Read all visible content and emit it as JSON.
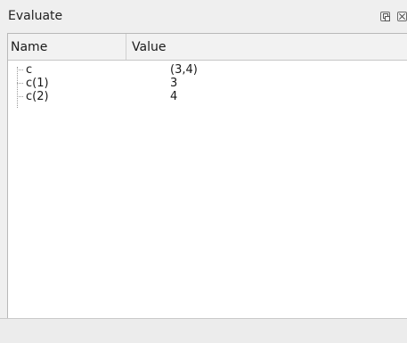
{
  "window": {
    "title": "Evaluate"
  },
  "table": {
    "columns": [
      "Name",
      "Value"
    ],
    "rows": [
      {
        "name": "c",
        "value": "(3,4)"
      },
      {
        "name": "c(1)",
        "value": "3"
      },
      {
        "name": "c(2)",
        "value": "4"
      }
    ]
  },
  "icons": {
    "float": "float-window-icon",
    "close": "close-icon"
  }
}
